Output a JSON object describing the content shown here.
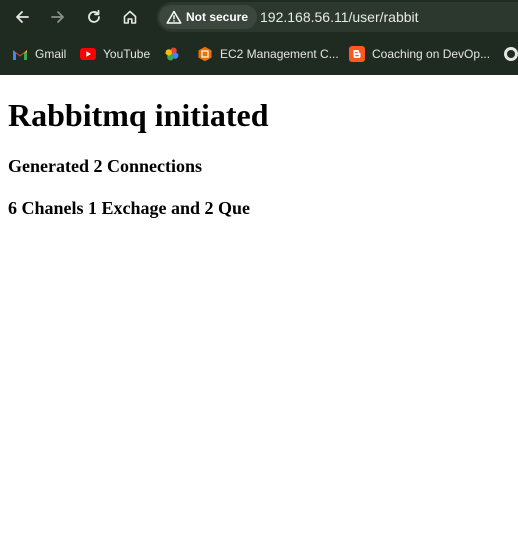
{
  "browser": {
    "security_label": "Not secure",
    "url": "192.168.56.11/user/rabbit",
    "bookmarks": [
      {
        "label": "Gmail",
        "icon": "gmail-icon"
      },
      {
        "label": "YouTube",
        "icon": "youtube-icon"
      },
      {
        "label": "",
        "icon": "pinwheel-icon"
      },
      {
        "label": "EC2 Management C...",
        "icon": "aws-ec2-icon"
      },
      {
        "label": "Coaching on DevOp...",
        "icon": "blogger-icon"
      }
    ]
  },
  "page": {
    "heading": "Rabbitmq initiated",
    "line1": "Generated 2 Connections",
    "line2": "6 Chanels 1 Exchage and 2 Que"
  },
  "colors": {
    "chrome_bg": "#1f2a20",
    "omnibox_bg": "#2c372d",
    "page_bg": "#ffffff"
  }
}
